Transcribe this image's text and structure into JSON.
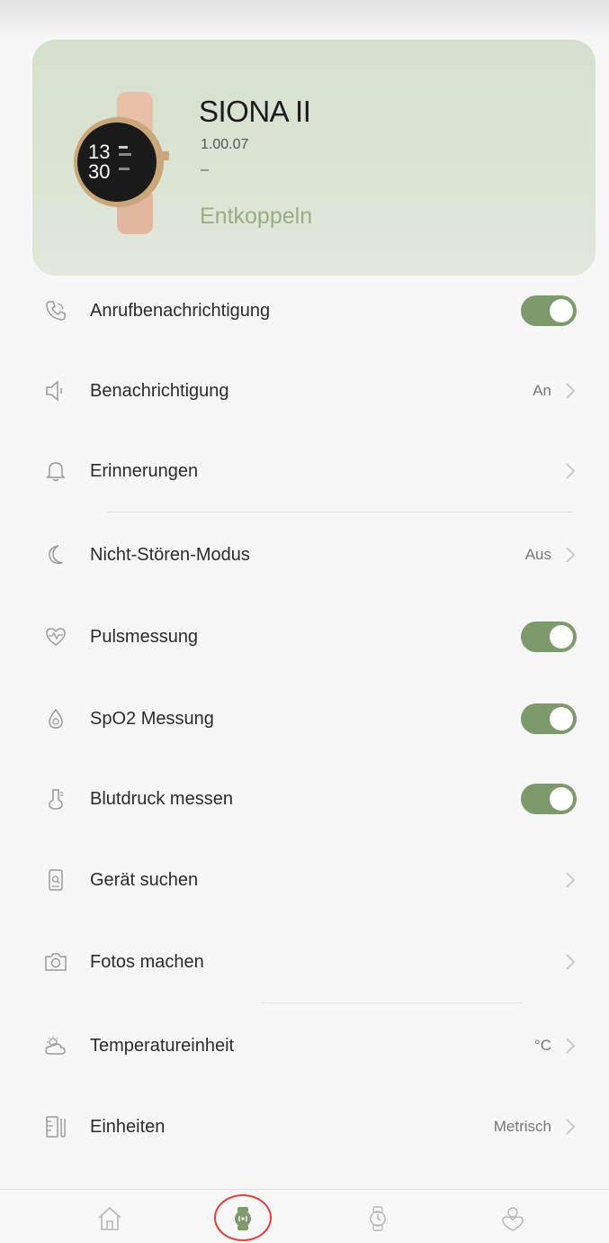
{
  "device": {
    "name": "SIONA II",
    "version": "1.00.07",
    "extra": "–",
    "unpair_label": "Entkoppeln",
    "watch_face_time_hour": "13",
    "watch_face_time_min": "30"
  },
  "settings": [
    {
      "label": "Anrufbenachrichtigung",
      "icon": "phone-icon",
      "control": "toggle",
      "on": true
    },
    {
      "label": "Benachrichtigung",
      "icon": "speaker-icon",
      "control": "link",
      "value": "An"
    },
    {
      "label": "Erinnerungen",
      "icon": "bell-icon",
      "control": "link",
      "value": ""
    },
    {
      "label": "Nicht-Stören-Modus",
      "icon": "moon-icon",
      "control": "link",
      "value": "Aus"
    },
    {
      "label": "Pulsmessung",
      "icon": "heart-pulse-icon",
      "control": "toggle",
      "on": true
    },
    {
      "label": "SpO2 Messung",
      "icon": "drop-icon",
      "control": "toggle",
      "on": true
    },
    {
      "label": "Blutdruck messen",
      "icon": "thermometer-icon",
      "control": "toggle",
      "on": true
    },
    {
      "label": "Gerät suchen",
      "icon": "watch-search-icon",
      "control": "link",
      "value": ""
    },
    {
      "label": "Fotos machen",
      "icon": "camera-icon",
      "control": "link",
      "value": ""
    },
    {
      "label": "Temperatureinheit",
      "icon": "weather-icon",
      "control": "link",
      "value": "°C"
    },
    {
      "label": "Einheiten",
      "icon": "ruler-icon",
      "control": "link",
      "value": "Metrisch"
    }
  ],
  "tabbar": {
    "items": [
      {
        "name": "home-icon"
      },
      {
        "name": "device-icon",
        "active": true
      },
      {
        "name": "watch-icon"
      },
      {
        "name": "profile-icon"
      }
    ]
  },
  "colors": {
    "accent": "#7d9a6c",
    "card": "#d8e1cf",
    "unpair": "#98ad86",
    "annotation": "#e0403a"
  }
}
